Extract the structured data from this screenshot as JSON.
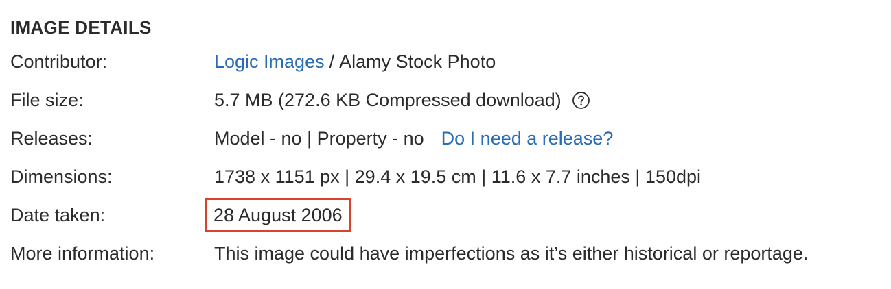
{
  "heading": "IMAGE DETAILS",
  "rows": {
    "contributor": {
      "label": "Contributor:",
      "link_text": "Logic Images",
      "separator": "/",
      "agency": "Alamy Stock Photo"
    },
    "file_size": {
      "label": "File size:",
      "value": "5.7 MB (272.6 KB Compressed download)",
      "help_icon": "question-circle-icon"
    },
    "releases": {
      "label": "Releases:",
      "value": "Model - no | Property - no",
      "link_text": "Do I need a release?"
    },
    "dimensions": {
      "label": "Dimensions:",
      "value": "1738 x 1151 px | 29.4 x 19.5 cm | 11.6 x 7.7 inches | 150dpi"
    },
    "date_taken": {
      "label": "Date taken:",
      "value": "28 August 2006",
      "highlight_color": "#d9432b"
    },
    "more_information": {
      "label": "More information:",
      "value": "This image could have imperfections as it’s either historical or reportage."
    }
  },
  "colors": {
    "text": "#2b2b2b",
    "link": "#2a6db5",
    "highlight": "#d9432b"
  }
}
